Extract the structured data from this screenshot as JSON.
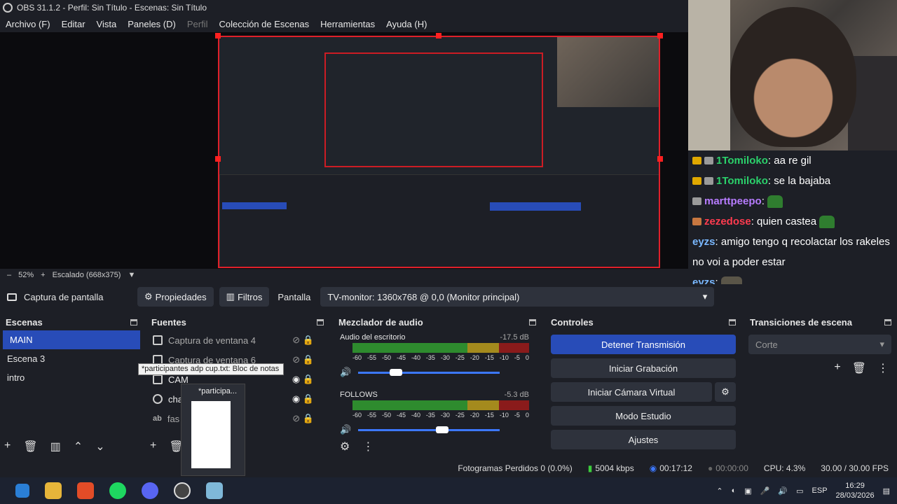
{
  "window": {
    "title": "OBS 31.1.2 - Perfil: Sin Título - Escenas: Sin Título"
  },
  "menu": [
    "Archivo (F)",
    "Editar",
    "Vista",
    "Paneles (D)",
    "Perfil",
    "Colección de Escenas",
    "Herramientas",
    "Ayuda (H)"
  ],
  "chat": [
    {
      "user": "1Tomiloko",
      "text": ": aa re gil",
      "style": "green"
    },
    {
      "user": "1Tomiloko",
      "text": ": se la bajaba",
      "style": "green"
    },
    {
      "user": "marttpeepo",
      "text": ":",
      "style": "purple"
    },
    {
      "user": "zezedose",
      "text": ": quien castea",
      "style": "red"
    },
    {
      "user": "eyzs",
      "text": ": amigo tengo q recolactar los rakeles",
      "style": "blue"
    },
    {
      "user": "",
      "text": "no voi a poder estar",
      "style": "blue"
    },
    {
      "user": "eyzs",
      "text": ":",
      "style": "blue"
    }
  ],
  "zoom": {
    "percent": "52%",
    "scaled": "Escalado (668x375)"
  },
  "source_bar": {
    "source": "Captura de pantalla",
    "properties": "Propiedades",
    "filters": "Filtros",
    "display_label": "Pantalla",
    "display_value": "TV-monitor: 1360x768 @ 0,0 (Monitor principal)"
  },
  "scenes": {
    "title": "Escenas",
    "items": [
      "MAIN",
      "Escena 3",
      "intro"
    ]
  },
  "sources": {
    "title": "Fuentes",
    "items": [
      "Captura de ventana 4",
      "Captura de ventana 6",
      "CAM",
      "cha",
      "fas"
    ]
  },
  "mixer": {
    "title": "Mezclador de audio",
    "channels": [
      {
        "name": "Audio del escritorio",
        "db": "-17.5 dB",
        "level": 0.22
      },
      {
        "name": "FOLLOWS",
        "db": "-5.3 dB",
        "level": 0.55
      }
    ],
    "scale": [
      "-60",
      "-55",
      "-50",
      "-45",
      "-40",
      "-35",
      "-30",
      "-25",
      "-20",
      "-15",
      "-10",
      "-5",
      "0"
    ]
  },
  "controls": {
    "title": "Controles",
    "buttons": [
      "Detener Transmisión",
      "Iniciar Grabación",
      "Iniciar Cámara Virtual",
      "Modo Estudio",
      "Ajustes"
    ]
  },
  "transitions": {
    "title": "Transiciones de escena",
    "selected": "Corte"
  },
  "tooltip": "*participantes adp cup.txt: Bloc de notas",
  "thumb_title": "*participa...",
  "status": {
    "dropped": "Fotogramas Perdidos 0 (0.0%)",
    "kbps": "5004 kbps",
    "live": "00:17:12",
    "rec": "00:00:00",
    "cpu": "CPU: 4.3%",
    "fps": "30.00 / 30.00 FPS"
  },
  "taskbar": {
    "lang": "ESP",
    "time": "16:29",
    "date": "28/03/2026"
  },
  "colors": {
    "accent": "#284cb8",
    "selection_border": "#e0202a"
  }
}
